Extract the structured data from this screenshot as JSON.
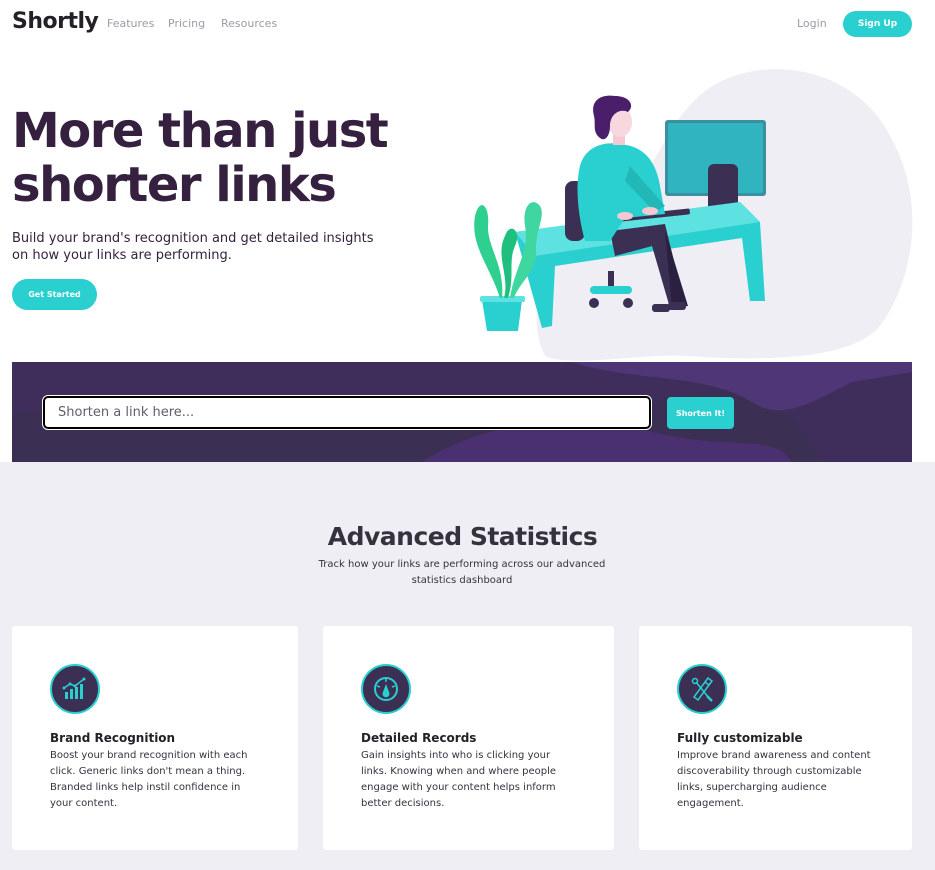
{
  "nav": {
    "logo": "Shortly",
    "links": [
      "Features",
      "Pricing",
      "Resources"
    ],
    "login": "Login",
    "signup": "Sign Up"
  },
  "hero": {
    "title": "More than just shorter links",
    "subtitle": "Build your brand's recognition and get detailed insights on how your links are performing.",
    "cta": "Get Started",
    "illustration": "person-working-at-desk-illustration"
  },
  "shorten": {
    "placeholder": "Shorten a link here...",
    "button": "Shorten It!"
  },
  "stats": {
    "title": "Advanced Statistics",
    "subtitle": "Track how your links are performing across our advanced statistics dashboard",
    "cards": [
      {
        "icon": "brand-recognition-icon",
        "title": "Brand Recognition",
        "text": "Boost your brand recognition with each click. Generic links don't mean a thing. Branded links help instil confidence in your content."
      },
      {
        "icon": "detailed-records-icon",
        "title": "Detailed Records",
        "text": "Gain insights into who is clicking your links. Knowing when and where people engage with your content helps inform better decisions."
      },
      {
        "icon": "fully-customizable-icon",
        "title": "Fully customizable",
        "text": "Improve brand awareness and content discoverability through customizable links, supercharging audience engagement."
      }
    ]
  },
  "colors": {
    "cyan": "#2acfcf",
    "dark_violet": "#3b3054",
    "heading": "#35213f",
    "gray": "#9e9aa7",
    "stats_bg": "#efeef5"
  }
}
